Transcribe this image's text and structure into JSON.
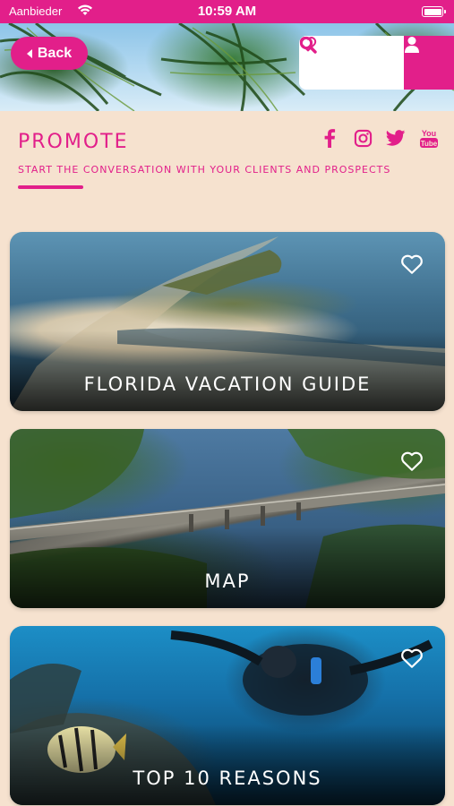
{
  "status_bar": {
    "carrier": "Aanbieder",
    "time": "10:59 AM"
  },
  "header": {
    "back_label": "Back",
    "icons": [
      "heart-outline-icon",
      "search-icon",
      "user-icon"
    ]
  },
  "section": {
    "title": "PROMOTE",
    "subtitle": "START THE CONVERSATION WITH YOUR CLIENTS AND PROSPECTS",
    "socials": [
      "facebook-icon",
      "instagram-icon",
      "twitter-icon",
      "youtube-icon"
    ],
    "youtube_text": [
      "You",
      "Tube"
    ]
  },
  "cards": [
    {
      "title": "FLORIDA VACATION GUIDE"
    },
    {
      "title": "MAP"
    },
    {
      "title": "TOP 10 REASONS"
    }
  ],
  "colors": {
    "accent": "#e21f8a",
    "background": "#f6e2cf"
  }
}
